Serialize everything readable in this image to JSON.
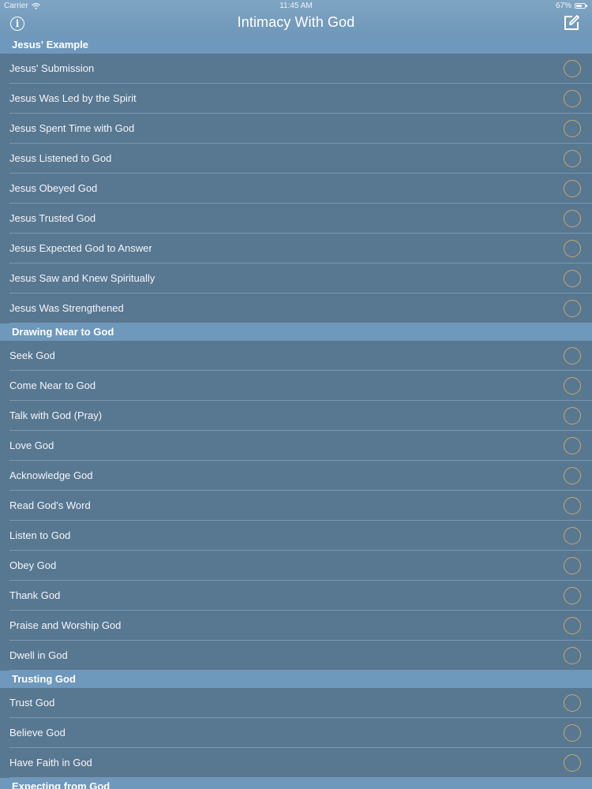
{
  "status": {
    "carrier": "Carrier",
    "time": "11:45 AM",
    "battery": "67%",
    "battery_level": 0.67
  },
  "nav": {
    "title": "Intimacy With God"
  },
  "sections": [
    {
      "title": "Jesus' Example",
      "items": [
        "Jesus' Submission",
        "Jesus Was Led by the Spirit",
        "Jesus Spent Time with God",
        "Jesus Listened to God",
        "Jesus Obeyed God",
        "Jesus Trusted God",
        "Jesus Expected God to Answer",
        "Jesus Saw and Knew Spiritually",
        "Jesus Was Strengthened"
      ]
    },
    {
      "title": "Drawing Near to God",
      "items": [
        "Seek God",
        "Come Near to God",
        "Talk with God (Pray)",
        "Love God",
        "Acknowledge God",
        "Read God's Word",
        "Listen to God",
        "Obey God",
        "Thank God",
        "Praise and Worship God",
        "Dwell in God"
      ]
    },
    {
      "title": "Trusting God",
      "items": [
        "Trust God",
        "Believe God",
        "Have Faith in God"
      ]
    },
    {
      "title": "Expecting from God",
      "items": []
    }
  ],
  "colors": {
    "nav_bar": "#6f97b8",
    "section_header": "#6e98bc",
    "row_bg": "#587791",
    "check_ring": "#c9a86a"
  },
  "icons": {
    "info": "info-icon",
    "compose": "compose-icon",
    "check": "checkmark-circle-icon"
  }
}
